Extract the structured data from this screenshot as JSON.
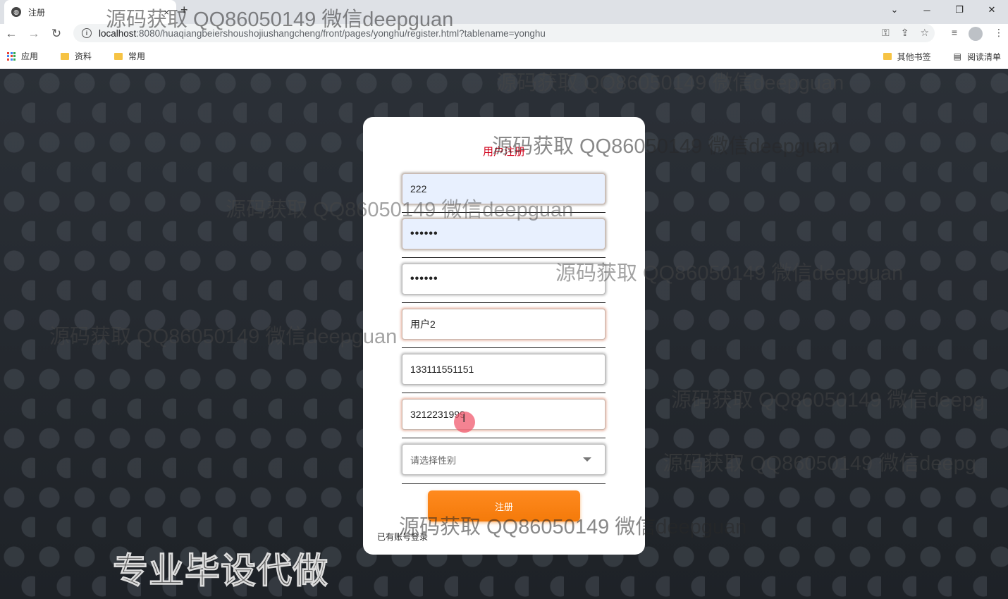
{
  "browser": {
    "tab_title": "注册",
    "tab_close": "×",
    "new_tab": "+",
    "url_host": "localhost",
    "url_rest": ":8080/huaqiangbeiershoushojiushangcheng/front/pages/yonghu/register.html?tablename=yonghu",
    "bookmarks": [
      "应用",
      "资料",
      "常用"
    ],
    "bookmarks_right": [
      "其他书签",
      "阅读清单"
    ]
  },
  "form": {
    "title": "用户注册",
    "account": "222",
    "password": "••••••",
    "password_confirm": "••••••",
    "name": "用户2",
    "phone": "133111551151",
    "id_number": "3212231999",
    "gender_placeholder": "请选择性别",
    "submit_label": "注册",
    "login_link": "已有账号登录"
  },
  "watermark": {
    "text": "源码获取 QQ86050149 微信deepguan",
    "text_cut": "源码获取 QQ86050149 微信deepg",
    "banner": "专业毕设代做"
  }
}
